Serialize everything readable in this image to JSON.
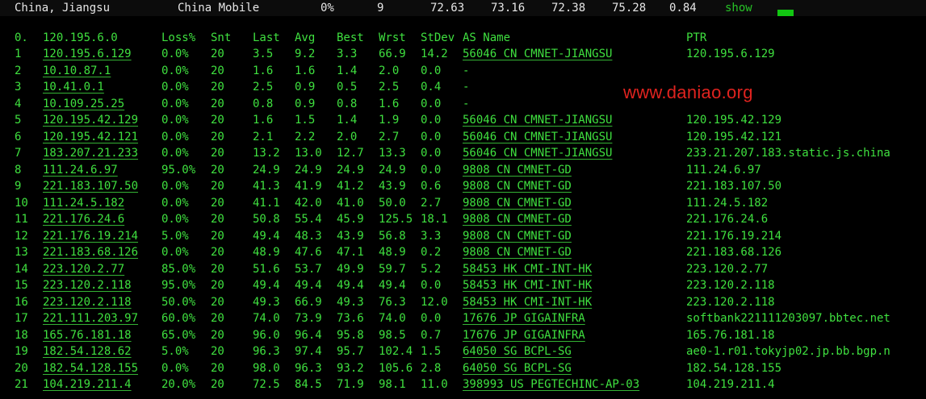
{
  "summary": {
    "location": "China, Jiangsu",
    "isp": "China Mobile",
    "loss": "0%",
    "snt": "9",
    "v1": "72.63",
    "v2": "73.16",
    "v3": "72.38",
    "v4": "75.28",
    "v5": "0.84",
    "show_label": "show"
  },
  "columns": {
    "hop": "0.",
    "host": "120.195.6.0",
    "loss": "Loss%",
    "snt": "Snt",
    "last": "Last",
    "avg": "Avg",
    "best": "Best",
    "wrst": "Wrst",
    "stdev": "StDev",
    "asname": "AS Name",
    "ptr": "PTR"
  },
  "watermark": "www.daniao.org",
  "rows": [
    {
      "hop": "1",
      "host": "120.195.6.129",
      "loss": "0.0%",
      "snt": "20",
      "last": "3.5",
      "avg": "9.2",
      "best": "3.3",
      "wrst": "66.9",
      "stdev": "14.2",
      "asname": "56046 CN CMNET-JIANGSU",
      "ptr": "120.195.6.129"
    },
    {
      "hop": "2",
      "host": "10.10.87.1",
      "loss": "0.0%",
      "snt": "20",
      "last": "1.6",
      "avg": "1.6",
      "best": "1.4",
      "wrst": "2.0",
      "stdev": "0.0",
      "asname": "-",
      "ptr": ""
    },
    {
      "hop": "3",
      "host": "10.41.0.1",
      "loss": "0.0%",
      "snt": "20",
      "last": "2.5",
      "avg": "0.9",
      "best": "0.5",
      "wrst": "2.5",
      "stdev": "0.4",
      "asname": "-",
      "ptr": ""
    },
    {
      "hop": "4",
      "host": "10.109.25.25",
      "loss": "0.0%",
      "snt": "20",
      "last": "0.8",
      "avg": "0.9",
      "best": "0.8",
      "wrst": "1.6",
      "stdev": "0.0",
      "asname": "-",
      "ptr": ""
    },
    {
      "hop": "5",
      "host": "120.195.42.129",
      "loss": "0.0%",
      "snt": "20",
      "last": "1.6",
      "avg": "1.5",
      "best": "1.4",
      "wrst": "1.9",
      "stdev": "0.0",
      "asname": "56046 CN CMNET-JIANGSU",
      "ptr": "120.195.42.129"
    },
    {
      "hop": "6",
      "host": "120.195.42.121",
      "loss": "0.0%",
      "snt": "20",
      "last": "2.1",
      "avg": "2.2",
      "best": "2.0",
      "wrst": "2.7",
      "stdev": "0.0",
      "asname": "56046 CN CMNET-JIANGSU",
      "ptr": "120.195.42.121"
    },
    {
      "hop": "7",
      "host": "183.207.21.233",
      "loss": "0.0%",
      "snt": "20",
      "last": "13.2",
      "avg": "13.0",
      "best": "12.7",
      "wrst": "13.3",
      "stdev": "0.0",
      "asname": "56046 CN CMNET-JIANGSU",
      "ptr": "233.21.207.183.static.js.china"
    },
    {
      "hop": "8",
      "host": "111.24.6.97",
      "loss": "95.0%",
      "snt": "20",
      "last": "24.9",
      "avg": "24.9",
      "best": "24.9",
      "wrst": "24.9",
      "stdev": "0.0",
      "asname": "9808  CN CMNET-GD",
      "ptr": "111.24.6.97"
    },
    {
      "hop": "9",
      "host": "221.183.107.50",
      "loss": "0.0%",
      "snt": "20",
      "last": "41.3",
      "avg": "41.9",
      "best": "41.2",
      "wrst": "43.9",
      "stdev": "0.6",
      "asname": "9808  CN CMNET-GD",
      "ptr": "221.183.107.50"
    },
    {
      "hop": "10",
      "host": "111.24.5.182",
      "loss": "0.0%",
      "snt": "20",
      "last": "41.1",
      "avg": "42.0",
      "best": "41.0",
      "wrst": "50.0",
      "stdev": "2.7",
      "asname": "9808  CN CMNET-GD",
      "ptr": "111.24.5.182"
    },
    {
      "hop": "11",
      "host": "221.176.24.6",
      "loss": "0.0%",
      "snt": "20",
      "last": "50.8",
      "avg": "55.4",
      "best": "45.9",
      "wrst": "125.5",
      "stdev": "18.1",
      "asname": "9808  CN CMNET-GD",
      "ptr": "221.176.24.6"
    },
    {
      "hop": "12",
      "host": "221.176.19.214",
      "loss": "5.0%",
      "snt": "20",
      "last": "49.4",
      "avg": "48.3",
      "best": "43.9",
      "wrst": "56.8",
      "stdev": "3.3",
      "asname": "9808  CN CMNET-GD",
      "ptr": "221.176.19.214"
    },
    {
      "hop": "13",
      "host": "221.183.68.126",
      "loss": "0.0%",
      "snt": "20",
      "last": "48.9",
      "avg": "47.6",
      "best": "47.1",
      "wrst": "48.9",
      "stdev": "0.2",
      "asname": "9808  CN CMNET-GD",
      "ptr": "221.183.68.126"
    },
    {
      "hop": "14",
      "host": "223.120.2.77",
      "loss": "85.0%",
      "snt": "20",
      "last": "51.6",
      "avg": "53.7",
      "best": "49.9",
      "wrst": "59.7",
      "stdev": "5.2",
      "asname": "58453 HK CMI-INT-HK",
      "ptr": "223.120.2.77"
    },
    {
      "hop": "15",
      "host": "223.120.2.118",
      "loss": "95.0%",
      "snt": "20",
      "last": "49.4",
      "avg": "49.4",
      "best": "49.4",
      "wrst": "49.4",
      "stdev": "0.0",
      "asname": "58453 HK CMI-INT-HK",
      "ptr": "223.120.2.118"
    },
    {
      "hop": "16",
      "host": "223.120.2.118",
      "loss": "50.0%",
      "snt": "20",
      "last": "49.3",
      "avg": "66.9",
      "best": "49.3",
      "wrst": "76.3",
      "stdev": "12.0",
      "asname": "58453 HK CMI-INT-HK",
      "ptr": "223.120.2.118"
    },
    {
      "hop": "17",
      "host": "221.111.203.97",
      "loss": "60.0%",
      "snt": "20",
      "last": "74.0",
      "avg": "73.9",
      "best": "73.6",
      "wrst": "74.0",
      "stdev": "0.0",
      "asname": "17676 JP GIGAINFRA",
      "ptr": "softbank221111203097.bbtec.net"
    },
    {
      "hop": "18",
      "host": "165.76.181.18",
      "loss": "65.0%",
      "snt": "20",
      "last": "96.0",
      "avg": "96.4",
      "best": "95.8",
      "wrst": "98.5",
      "stdev": "0.7",
      "asname": "17676 JP GIGAINFRA",
      "ptr": "165.76.181.18"
    },
    {
      "hop": "19",
      "host": "182.54.128.62",
      "loss": "5.0%",
      "snt": "20",
      "last": "96.3",
      "avg": "97.4",
      "best": "95.7",
      "wrst": "102.4",
      "stdev": "1.5",
      "asname": "64050 SG BCPL-SG",
      "ptr": "ae0-1.r01.tokyjp02.jp.bb.bgp.n"
    },
    {
      "hop": "20",
      "host": "182.54.128.155",
      "loss": "0.0%",
      "snt": "20",
      "last": "98.0",
      "avg": "96.3",
      "best": "93.2",
      "wrst": "105.6",
      "stdev": "2.8",
      "asname": "64050 SG BCPL-SG",
      "ptr": "182.54.128.155"
    },
    {
      "hop": "21",
      "host": "104.219.211.4",
      "loss": "20.0%",
      "snt": "20",
      "last": "72.5",
      "avg": "84.5",
      "best": "71.9",
      "wrst": "98.1",
      "stdev": "11.0",
      "asname": "398993 US PEGTECHINC-AP-03",
      "ptr": "104.219.211.4"
    }
  ]
}
